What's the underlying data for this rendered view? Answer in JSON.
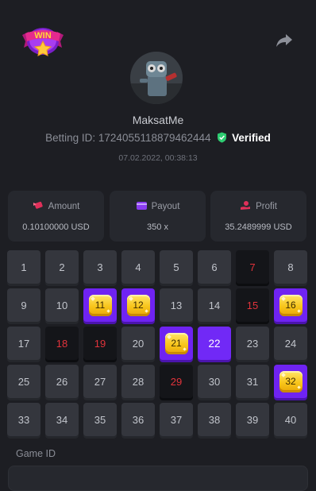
{
  "badge": {
    "text": "WIN"
  },
  "header": {
    "share_icon": "share-arrow-icon"
  },
  "player": {
    "username": "MaksatMe",
    "betting_id_label": "Betting ID:",
    "betting_id": "1724055118879462444",
    "verified_label": "Verified",
    "datetime": "07.02.2022, 00:38:13"
  },
  "stats": {
    "amount": {
      "label": "Amount",
      "value": "0.10100000 USD",
      "icon": "money-wings-icon"
    },
    "payout": {
      "label": "Payout",
      "value": "350 x",
      "icon": "wallet-icon"
    },
    "profit": {
      "label": "Profit",
      "value": "35.2489999 USD",
      "icon": "hand-coins-icon"
    }
  },
  "board": {
    "cells": [
      {
        "n": "1",
        "s": "normal"
      },
      {
        "n": "2",
        "s": "normal"
      },
      {
        "n": "3",
        "s": "normal"
      },
      {
        "n": "4",
        "s": "normal"
      },
      {
        "n": "5",
        "s": "normal"
      },
      {
        "n": "6",
        "s": "normal"
      },
      {
        "n": "7",
        "s": "drawn"
      },
      {
        "n": "8",
        "s": "normal"
      },
      {
        "n": "9",
        "s": "normal"
      },
      {
        "n": "10",
        "s": "normal"
      },
      {
        "n": "11",
        "s": "hit"
      },
      {
        "n": "12",
        "s": "hit"
      },
      {
        "n": "13",
        "s": "normal"
      },
      {
        "n": "14",
        "s": "normal"
      },
      {
        "n": "15",
        "s": "drawn"
      },
      {
        "n": "16",
        "s": "hit"
      },
      {
        "n": "17",
        "s": "normal"
      },
      {
        "n": "18",
        "s": "drawn"
      },
      {
        "n": "19",
        "s": "drawn"
      },
      {
        "n": "20",
        "s": "normal"
      },
      {
        "n": "21",
        "s": "hit"
      },
      {
        "n": "22",
        "s": "selected"
      },
      {
        "n": "23",
        "s": "normal"
      },
      {
        "n": "24",
        "s": "normal"
      },
      {
        "n": "25",
        "s": "normal"
      },
      {
        "n": "26",
        "s": "normal"
      },
      {
        "n": "27",
        "s": "normal"
      },
      {
        "n": "28",
        "s": "normal"
      },
      {
        "n": "29",
        "s": "drawn"
      },
      {
        "n": "30",
        "s": "normal"
      },
      {
        "n": "31",
        "s": "normal"
      },
      {
        "n": "32",
        "s": "hit"
      },
      {
        "n": "33",
        "s": "normal"
      },
      {
        "n": "34",
        "s": "normal"
      },
      {
        "n": "35",
        "s": "normal"
      },
      {
        "n": "36",
        "s": "normal"
      },
      {
        "n": "37",
        "s": "normal"
      },
      {
        "n": "38",
        "s": "normal"
      },
      {
        "n": "39",
        "s": "normal"
      },
      {
        "n": "40",
        "s": "normal"
      }
    ]
  },
  "game": {
    "id_label": "Game ID"
  },
  "colors": {
    "accent_purple": "#7129f6",
    "drawn_red": "#e2333b",
    "gem_yellow": "#f8c51b",
    "verified_green": "#2ecc71"
  }
}
